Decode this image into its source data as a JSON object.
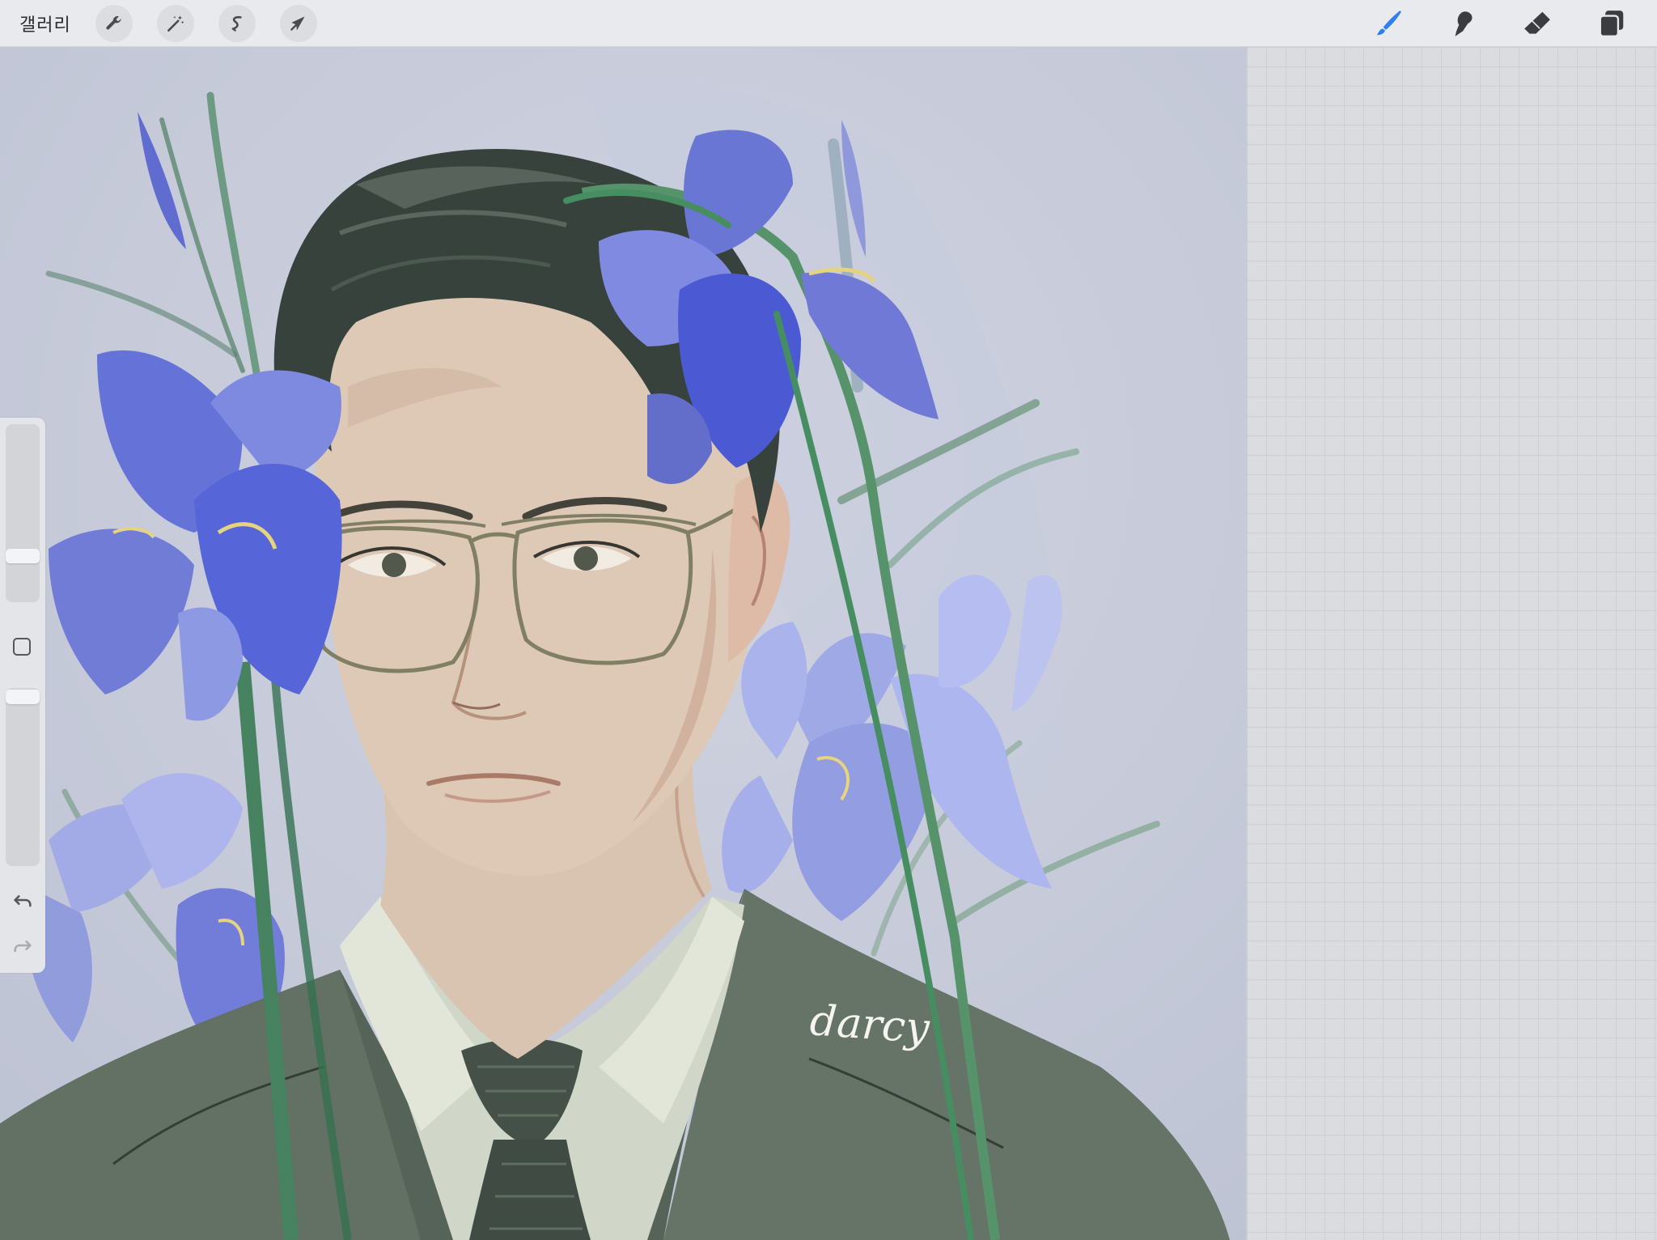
{
  "topbar": {
    "gallery_label": "갤러리",
    "left_tools": [
      {
        "name": "actions",
        "icon": "wrench-icon"
      },
      {
        "name": "adjustments",
        "icon": "magic-wand-icon"
      },
      {
        "name": "selection",
        "icon": "selection-s-icon"
      },
      {
        "name": "transform",
        "icon": "arrow-cursor-icon"
      }
    ],
    "right_tools": [
      {
        "name": "brush",
        "icon": "brush-icon",
        "active": true
      },
      {
        "name": "smudge",
        "icon": "smudge-icon",
        "active": false
      },
      {
        "name": "eraser",
        "icon": "eraser-icon",
        "active": false
      },
      {
        "name": "layers",
        "icon": "layers-icon",
        "active": false
      }
    ],
    "accent_color": "#2f80ed"
  },
  "canvas": {
    "signature_text": "darcy",
    "artwork": "portrait-with-irises"
  },
  "sidebar": {
    "brush_size_level": 0.72,
    "opacity_level": 0.05,
    "undo_icon": "undo-icon",
    "redo_icon": "redo-icon"
  },
  "colors": {
    "canvas_bg": "#c2c6d6",
    "iris_blue": "#6a74d6",
    "suit_green": "#5c6b5d",
    "hair_dark": "#2e3a33",
    "skin": "#dcc7b3"
  }
}
